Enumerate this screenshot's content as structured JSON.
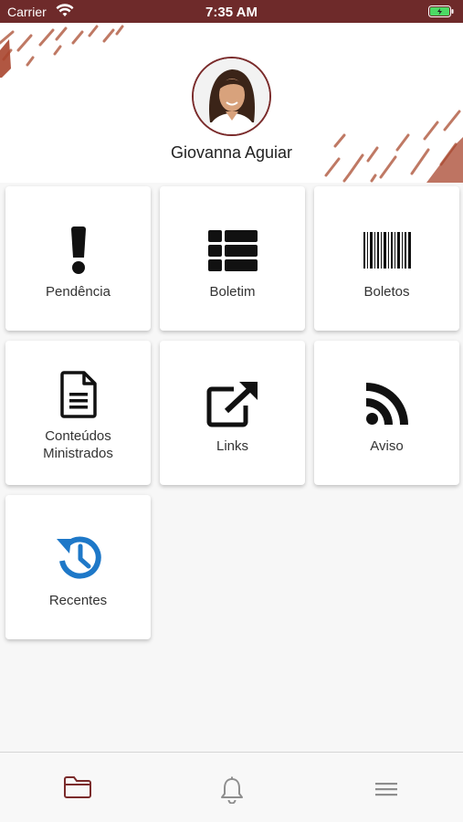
{
  "status_bar": {
    "carrier": "Carrier",
    "time": "7:35 AM"
  },
  "profile": {
    "name": "Giovanna Aguiar"
  },
  "tiles": [
    {
      "label": "Pendência",
      "icon": "exclamation-icon"
    },
    {
      "label": "Boletim",
      "icon": "table-list-icon"
    },
    {
      "label": "Boletos",
      "icon": "barcode-icon"
    },
    {
      "label": "Conteúdos\nMinistrados",
      "line1": "Conteúdos",
      "line2": "Ministrados",
      "icon": "document-icon"
    },
    {
      "label": "Links",
      "icon": "external-link-icon"
    },
    {
      "label": "Aviso",
      "icon": "rss-icon"
    },
    {
      "label": "Recentes",
      "icon": "history-icon"
    }
  ],
  "tabbar": {
    "items": [
      {
        "icon": "folder-icon",
        "active": true
      },
      {
        "icon": "bell-icon",
        "active": false
      },
      {
        "icon": "menu-icon",
        "active": false
      }
    ]
  },
  "colors": {
    "brand": "#6e2a2a",
    "accent_blue": "#1e78c8",
    "active_tab": "#7a2b2b",
    "inactive_tab": "#8e8e8e"
  }
}
